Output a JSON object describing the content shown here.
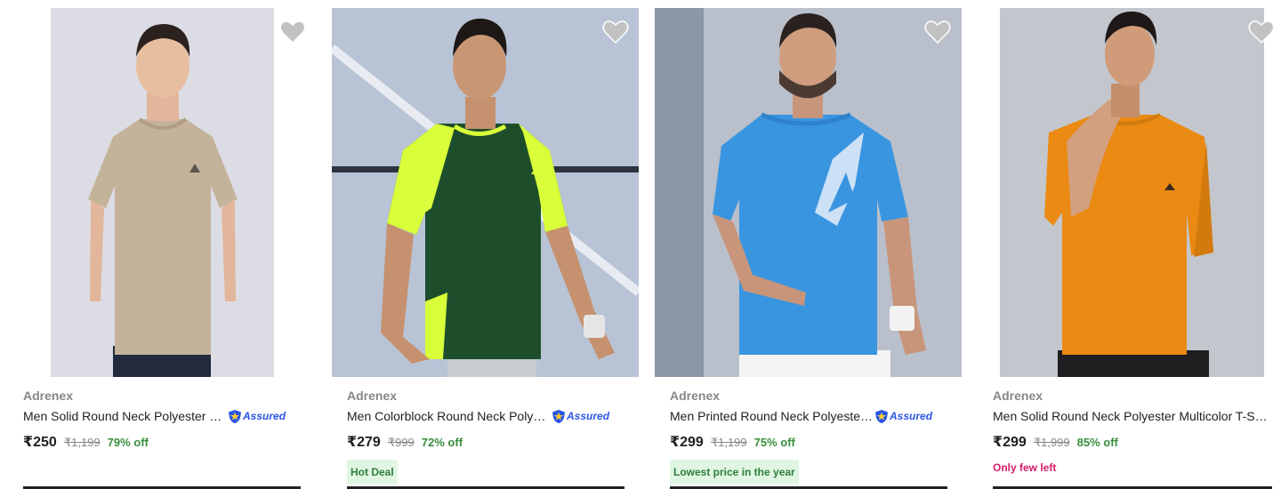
{
  "products": [
    {
      "brand": "Adrenex",
      "title": "Men Solid Round Neck Polyester Beige T-Shirt",
      "assured": "Assured",
      "price": "₹250",
      "mrp": "₹1,199",
      "discount": "79% off",
      "badge": "",
      "image": {
        "shirt_color": "#c4b39b",
        "bg_color": "#d9dbe3",
        "description_icon": "model-tshirt-image"
      }
    },
    {
      "brand": "Adrenex",
      "title": "Men Colorblock Round Neck Polyester Green T-Shirt",
      "assured": "Assured",
      "price": "₹279",
      "mrp": "₹999",
      "discount": "72% off",
      "badge": "Hot Deal",
      "image": {
        "shirt_color": "#1e4d2b",
        "accent_color": "#d8ff3a",
        "bg_color": "#b7c3d4",
        "description_icon": "model-tshirt-image"
      }
    },
    {
      "brand": "Adrenex",
      "title": "Men Printed Round Neck Polyester Blue T-Shirt",
      "assured": "Assured",
      "price": "₹299",
      "mrp": "₹1,199",
      "discount": "75% off",
      "badge": "Lowest price in the year",
      "image": {
        "shirt_color": "#3a95e0",
        "bg_color": "#a9b2bf",
        "description_icon": "model-tshirt-image"
      }
    },
    {
      "brand": "Adrenex",
      "title": "Men Solid Round Neck Polyester Multicolor T-Shirt",
      "assured": "",
      "price": "₹299",
      "mrp": "₹1,999",
      "discount": "85% off",
      "badge": "Only few left",
      "image": {
        "shirt_color": "#ea8a13",
        "bg_color": "#c2c6cc",
        "description_icon": "model-tshirt-image"
      }
    }
  ],
  "colors": {
    "discount": "#388e3c",
    "assured": "#2a55e5",
    "deal_badge_bg": "#e0f6e3",
    "few_left": "#d61a6b",
    "wishlist": "#c2c2c2"
  },
  "icons": {
    "wishlist": "heart-icon",
    "assured": "shield-assured-icon"
  }
}
